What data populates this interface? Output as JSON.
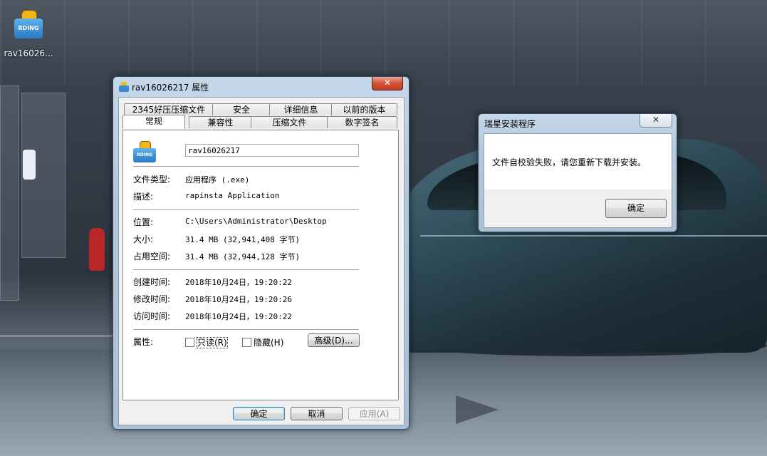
{
  "desktop": {
    "icon_label": "rav16026...",
    "icon_badge": "RDING"
  },
  "props_window": {
    "title": "rav16026217 属性",
    "close_glyph": "✕",
    "tabs_row1": [
      "2345好压压缩文件",
      "安全",
      "详细信息",
      "以前的版本"
    ],
    "tabs_row2": [
      "常规",
      "兼容性",
      "压缩文件",
      "数字签名"
    ],
    "active_tab": "常规",
    "file_name": "rav16026217",
    "fields": {
      "type_label": "文件类型:",
      "type_value": "应用程序 (.exe)",
      "desc_label": "描述:",
      "desc_value": "rapinsta Application",
      "location_label": "位置:",
      "location_value": "C:\\Users\\Administrator\\Desktop",
      "size_label": "大小:",
      "size_value": "31.4 MB (32,941,408 字节)",
      "disk_label": "占用空间:",
      "disk_value": "31.4 MB (32,944,128 字节)",
      "created_label": "创建时间:",
      "created_value": "2018年10月24日，19:20:22",
      "modified_label": "修改时间:",
      "modified_value": "2018年10月24日，19:20:26",
      "accessed_label": "访问时间:",
      "accessed_value": "2018年10月24日，19:20:22",
      "attrs_label": "属性:",
      "readonly_label": "只读(R)",
      "hidden_label": "隐藏(H)",
      "advanced_label": "高级(D)..."
    },
    "buttons": {
      "ok": "确定",
      "cancel": "取消",
      "apply": "应用(A)"
    }
  },
  "error_dialog": {
    "title": "瑞星安装程序",
    "close_glyph": "✕",
    "message": "文件自校验失败，请您重新下载并安装。",
    "ok": "确定"
  }
}
